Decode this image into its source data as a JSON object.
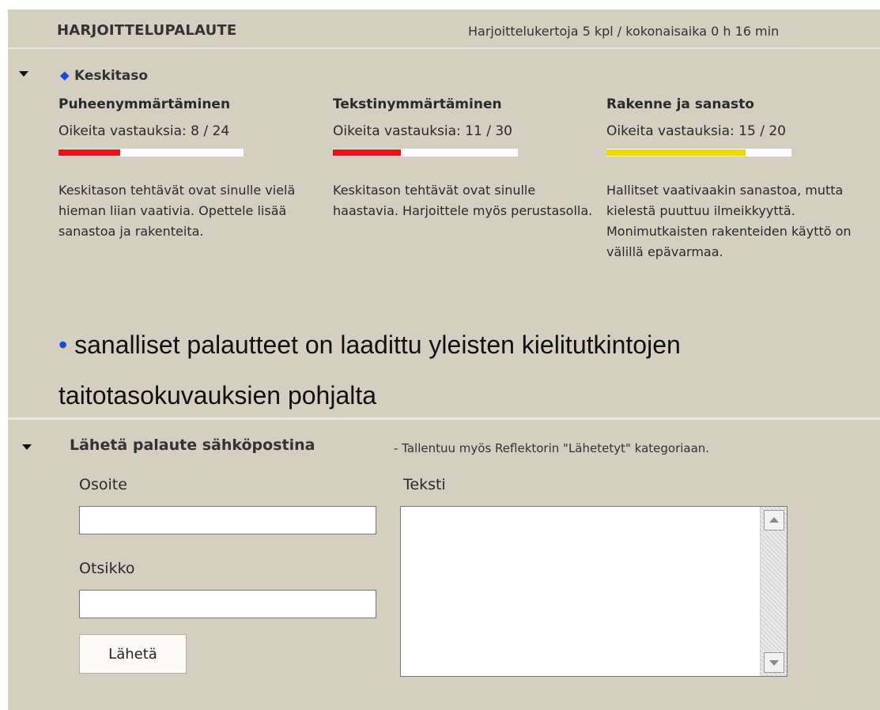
{
  "header": {
    "title": "HARJOITTELUPALAUTE",
    "stats": "Harjoittelukertoja 5 kpl / kokonaisaika 0 h 16 min"
  },
  "level": {
    "icon": "diamond-icon",
    "label": "Keskitaso"
  },
  "skills": [
    {
      "title": "Puheenymmärtäminen",
      "score_label": "Oikeita vastauksia:  8 / 24",
      "correct": 8,
      "total": 24,
      "bar_color": "#ee1111",
      "feedback": "Keskitason tehtävät ovat sinulle vielä hieman liian vaativia. Opettele lisää sanastoa ja rakenteita."
    },
    {
      "title": "Tekstinymmärtäminen",
      "score_label": "Oikeita vastauksia:  11 / 30",
      "correct": 11,
      "total": 30,
      "bar_color": "#ee1111",
      "feedback": "Keskitason tehtävät ovat sinulle haastavia. Harjoittele myös perustasolla."
    },
    {
      "title": "Rakenne ja sanasto",
      "score_label": "Oikeita vastauksia:  15 / 20",
      "correct": 15,
      "total": 20,
      "bar_color": "#f2d800",
      "feedback": "Hallitset vaativaakin sanastoa, mutta kielestä puuttuu ilmeikkyyttä. Monimutkaisten rakenteiden käyttö on välillä epävarmaa."
    }
  ],
  "note": {
    "bullet": "•",
    "text": " sanalliset palautteet on laadittu yleisten kielitutkintojen taitotasokuvauksien pohjalta"
  },
  "email": {
    "title": "Lähetä palaute sähköpostina",
    "note": "- Tallentuu myös Reflektorin \"Lähetetyt\" kategoriaan.",
    "address_label": "Osoite",
    "address_value": "",
    "subject_label": "Otsikko",
    "subject_value": "",
    "text_label": "Teksti",
    "text_value": "",
    "send_label": "Lähetä"
  },
  "colors": {
    "panel_bg": "#d4cfc0",
    "accent_blue": "#1a4ad8"
  }
}
